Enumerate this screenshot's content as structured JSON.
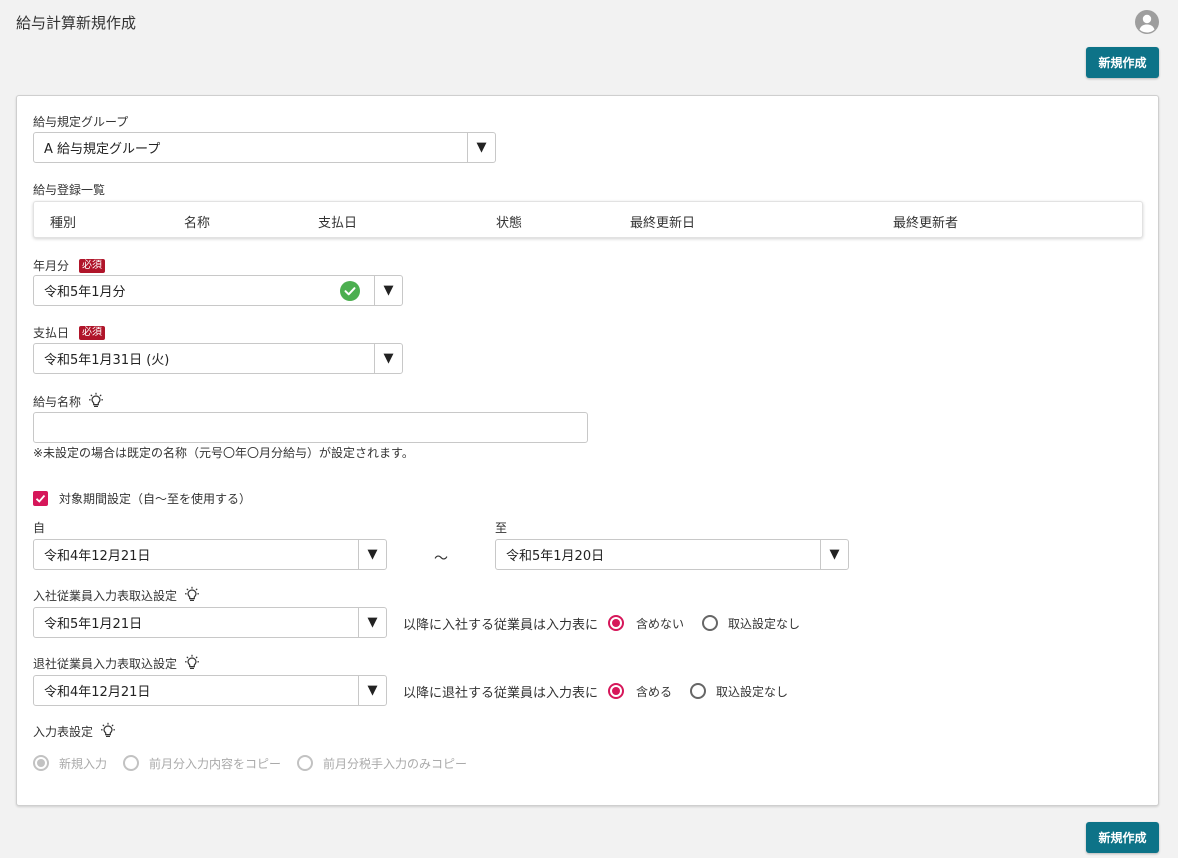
{
  "header": {
    "title": "給与計算新規作成",
    "create_label": "新規作成"
  },
  "footer": {
    "create_label": "新規作成"
  },
  "form": {
    "group": {
      "label": "給与規定グループ",
      "value": "A 給与規定グループ"
    },
    "list": {
      "label": "給与登録一覧",
      "columns": [
        "種別",
        "名称",
        "支払日",
        "状態",
        "最終更新日",
        "最終更新者"
      ]
    },
    "month": {
      "label": "年月分",
      "required": "必須",
      "value": "令和5年1月分"
    },
    "payday": {
      "label": "支払日",
      "required": "必須",
      "value": "令和5年1月31日 (火)"
    },
    "name": {
      "label": "給与名称",
      "value": "",
      "note": "※未設定の場合は既定の名称（元号〇年〇月分給与）が設定されます。"
    },
    "period": {
      "checkbox_label": "対象期間設定（自～至を使用する）",
      "from_label": "自",
      "from_value": "令和4年12月21日",
      "tilde": "～",
      "to_label": "至",
      "to_value": "令和5年1月20日"
    },
    "join": {
      "label": "入社従業員入力表取込設定",
      "value": "令和5年1月21日",
      "suffix": "以降に入社する従業員は入力表に",
      "options": [
        "含めない",
        "取込設定なし"
      ]
    },
    "leave": {
      "label": "退社従業員入力表取込設定",
      "value": "令和4年12月21日",
      "suffix": "以降に退社する従業員は入力表に",
      "options": [
        "含める",
        "取込設定なし"
      ]
    },
    "input_table": {
      "label": "入力表設定",
      "options": [
        "新規入力",
        "前月分入力内容をコピー",
        "前月分税手入力のみコピー"
      ]
    }
  },
  "colors": {
    "primary": "#0d7388",
    "accent": "#d6175a",
    "required": "#b0152a",
    "check": "#4caf50"
  }
}
